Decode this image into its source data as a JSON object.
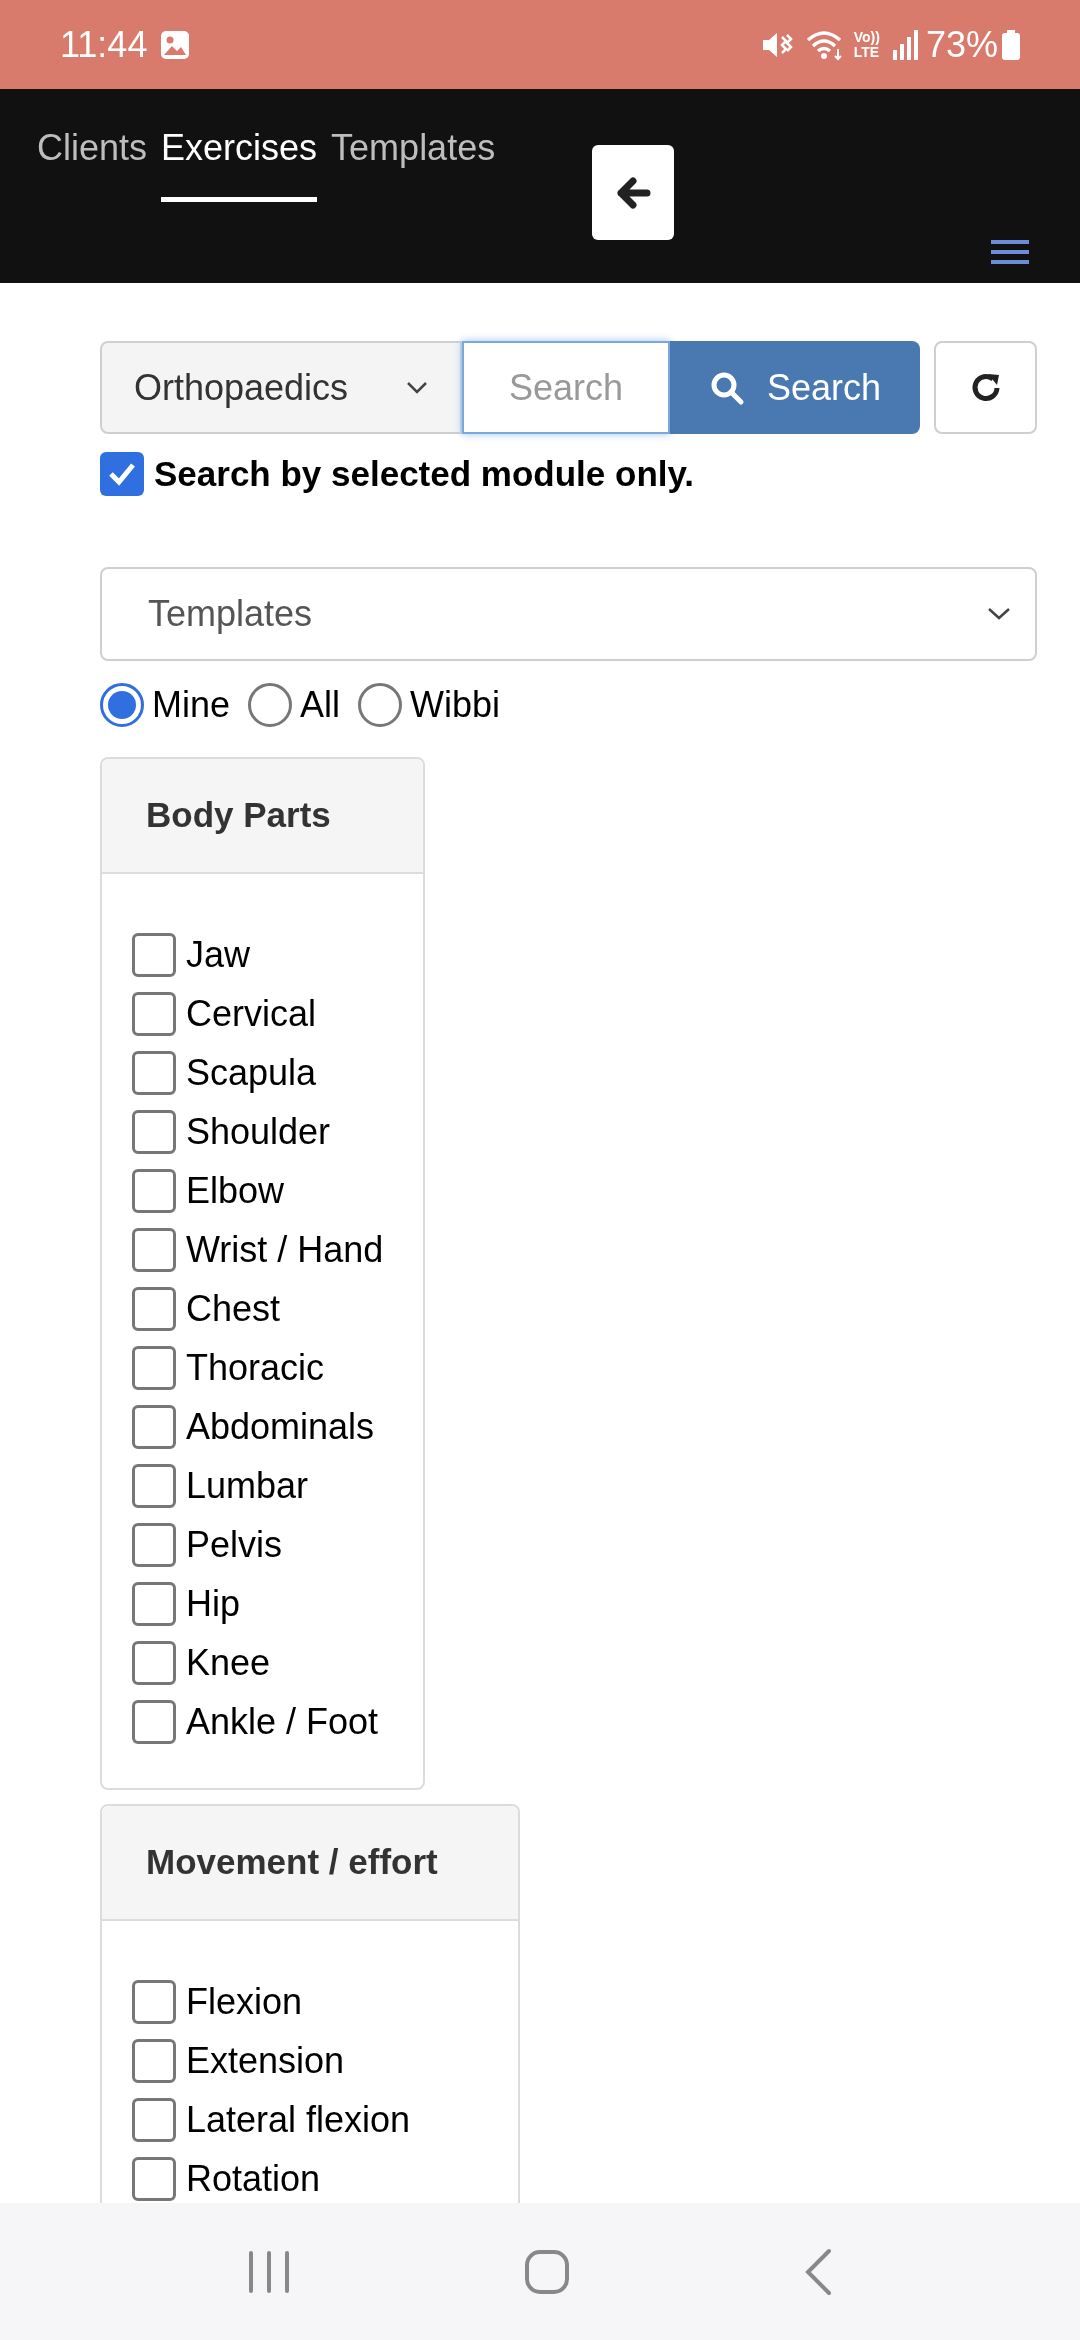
{
  "status_bar": {
    "time": "11:44",
    "volte_top": "Vo))",
    "volte_bottom": "LTE",
    "battery": "73%"
  },
  "nav": {
    "tabs": [
      {
        "label": "Clients",
        "selected": false
      },
      {
        "label": "Exercises",
        "selected": true
      },
      {
        "label": "Templates",
        "selected": false
      }
    ]
  },
  "search": {
    "module": "Orthopaedics",
    "placeholder": "Search",
    "button": "Search",
    "module_only": {
      "label": "Search by selected module only.",
      "checked": true
    }
  },
  "template_select": "Templates",
  "owner_filter": [
    {
      "label": "Mine",
      "selected": true
    },
    {
      "label": "All",
      "selected": false
    },
    {
      "label": "Wibbi",
      "selected": false
    }
  ],
  "filter_cards": [
    {
      "title": "Body Parts",
      "items": [
        {
          "label": "Jaw",
          "checked": false
        },
        {
          "label": "Cervical",
          "checked": false
        },
        {
          "label": "Scapula",
          "checked": false
        },
        {
          "label": "Shoulder",
          "checked": false
        },
        {
          "label": "Elbow",
          "checked": false
        },
        {
          "label": "Wrist / Hand",
          "checked": false
        },
        {
          "label": "Chest",
          "checked": false
        },
        {
          "label": "Thoracic",
          "checked": false
        },
        {
          "label": "Abdominals",
          "checked": false
        },
        {
          "label": "Lumbar",
          "checked": false
        },
        {
          "label": "Pelvis",
          "checked": false
        },
        {
          "label": "Hip",
          "checked": false
        },
        {
          "label": "Knee",
          "checked": false
        },
        {
          "label": "Ankle / Foot",
          "checked": false
        }
      ]
    },
    {
      "title": "Movement / effort",
      "items": [
        {
          "label": "Flexion",
          "checked": false
        },
        {
          "label": "Extension",
          "checked": false
        },
        {
          "label": "Lateral flexion",
          "checked": false
        },
        {
          "label": "Rotation",
          "checked": false
        }
      ]
    }
  ]
}
